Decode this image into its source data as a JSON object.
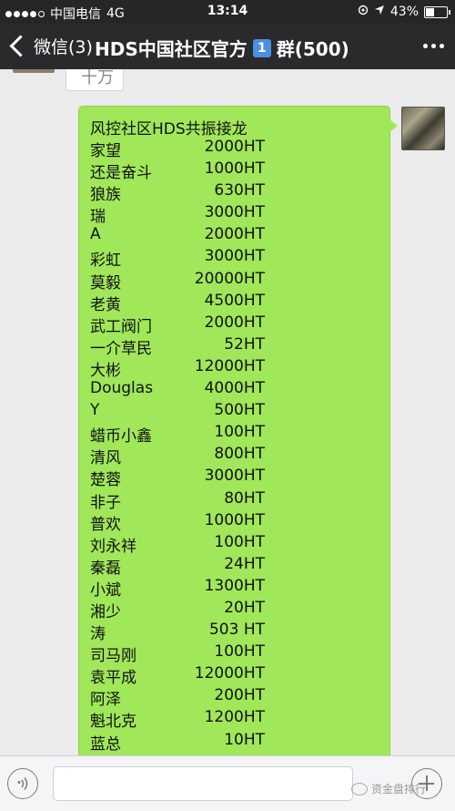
{
  "status_bar": {
    "carrier": "中国电信",
    "network": "4G",
    "time": "13:14",
    "battery": "43%"
  },
  "nav": {
    "back_label": "微信(3)",
    "title": "HDS中国社区官方",
    "badge": "1",
    "group_label": "群(500)"
  },
  "previous_message": {
    "text": "十万"
  },
  "message": {
    "title": "风控社区HDS共振接龙",
    "rows": [
      {
        "name": "家望",
        "amount": "2000HT"
      },
      {
        "name": "还是奋斗",
        "amount": "1000HT"
      },
      {
        "name": "狼族",
        "amount": "630HT"
      },
      {
        "name": "瑞",
        "amount": "3000HT"
      },
      {
        "name": "A",
        "amount": "2000HT"
      },
      {
        "name": "彩虹",
        "amount": "3000HT"
      },
      {
        "name": "莫毅",
        "amount": "20000HT"
      },
      {
        "name": "老黄",
        "amount": "4500HT"
      },
      {
        "name": "武工阀门",
        "amount": "2000HT"
      },
      {
        "name": "一介草民",
        "amount": "52HT"
      },
      {
        "name": "大彬",
        "amount": "12000HT"
      },
      {
        "name": "Douglas",
        "amount": "4000HT"
      },
      {
        "name": "Y",
        "amount": "500HT"
      },
      {
        "name": "蜡币小鑫",
        "amount": "100HT"
      },
      {
        "name": "清风",
        "amount": "800HT"
      },
      {
        "name": "楚蓉",
        "amount": "3000HT"
      },
      {
        "name": "非子",
        "amount": "80HT"
      },
      {
        "name": "普欢",
        "amount": "1000HT"
      },
      {
        "name": "刘永祥",
        "amount": "100HT"
      },
      {
        "name": "秦磊",
        "amount": "24HT"
      },
      {
        "name": "小斌",
        "amount": "1300HT"
      },
      {
        "name": "湘少",
        "amount": "20HT"
      },
      {
        "name": "涛",
        "amount": "503 HT"
      },
      {
        "name": "司马刚",
        "amount": "100HT"
      },
      {
        "name": "袁平成",
        "amount": "12000HT"
      },
      {
        "name": "阿泽",
        "amount": "200HT"
      },
      {
        "name": "魁北克",
        "amount": "1200HT"
      },
      {
        "name": "蓝总",
        "amount": "10HT"
      }
    ]
  },
  "watermark": {
    "text": "资金盘排行"
  },
  "colors": {
    "bubble_green": "#a0e75a",
    "nav_bg": "#2a2a2c",
    "chat_bg": "#ebebeb"
  }
}
